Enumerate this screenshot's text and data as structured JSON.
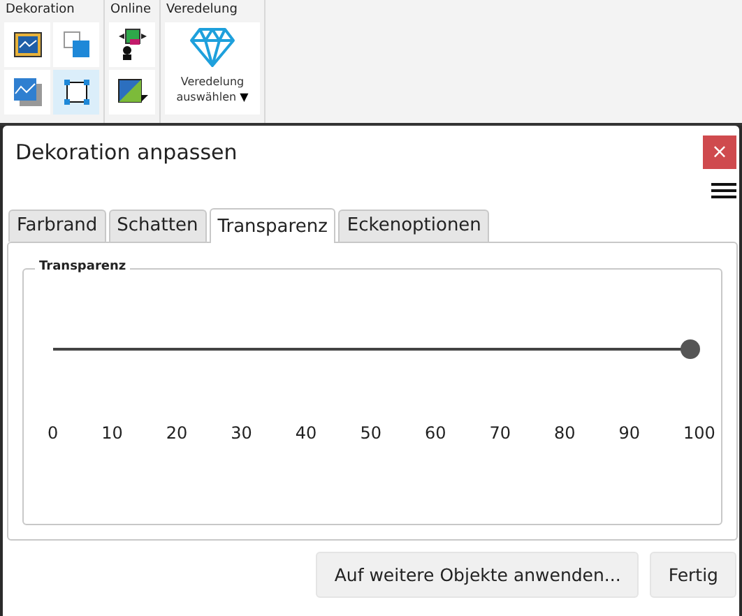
{
  "ribbon": {
    "groups": [
      {
        "title": "Dekoration",
        "tools": [
          {
            "kind": "frame",
            "selected": false
          },
          {
            "kind": "layers",
            "selected": false
          },
          {
            "kind": "shadow",
            "selected": false
          },
          {
            "kind": "crop",
            "selected": true
          }
        ]
      },
      {
        "title": "Online",
        "tools": [
          {
            "kind": "connect",
            "selected": false
          },
          {
            "kind": "fill",
            "selected": false
          }
        ]
      },
      {
        "title": "Veredelung",
        "big_button": {
          "label": "Veredelung auswählen",
          "caret": "▼"
        }
      }
    ]
  },
  "dialog": {
    "title": "Dekoration anpassen",
    "close": "×",
    "tabs": [
      {
        "label": "Farbrand",
        "selected": false
      },
      {
        "label": "Schatten",
        "selected": false
      },
      {
        "label": "Transparenz",
        "selected": true
      },
      {
        "label": "Eckenoptionen",
        "selected": false
      }
    ],
    "group": {
      "title": "Transparenz",
      "slider": {
        "level": 1.0,
        "ticks": [
          "0",
          "10",
          "20",
          "30",
          "40",
          "50",
          "60",
          "70",
          "80",
          "90",
          "100"
        ]
      }
    },
    "buttons": [
      "Auf weitere Objekte anwenden...",
      "Fertig"
    ]
  }
}
